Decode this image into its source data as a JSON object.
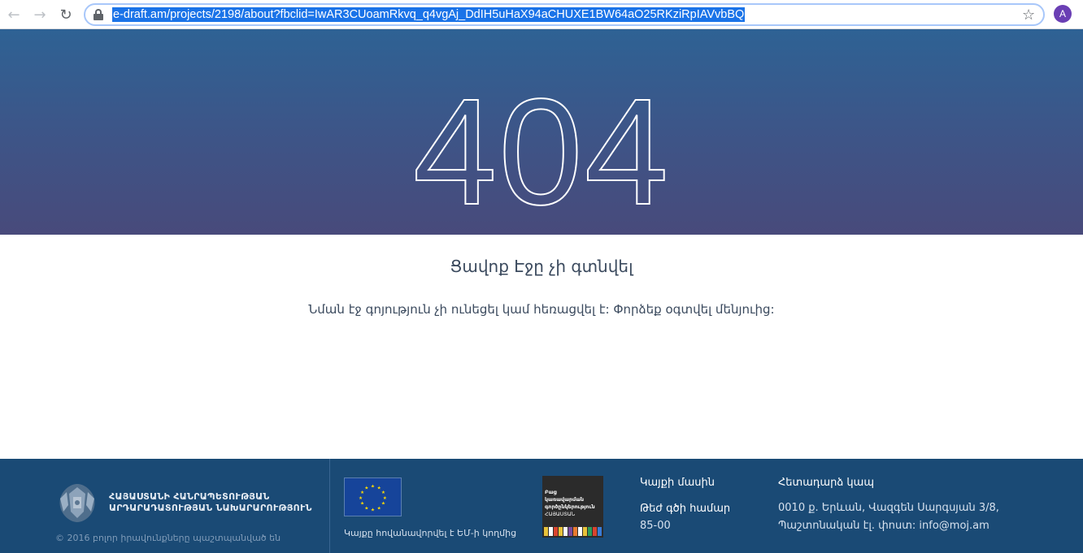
{
  "browser": {
    "back_icon": "arrow-left-icon",
    "forward_icon": "arrow-right-icon",
    "reload_icon": "reload-icon",
    "url": "e-draft.am/projects/2198/about?fbclid=IwAR3CUoamRkvq_q4vgAj_DdIH5uHaX94aCHUXE1BW64aO25RKziRpIAVvbBQ",
    "avatar_letter": "A",
    "accent_color": "#1a73e8",
    "avatar_color": "#6a3fb4"
  },
  "hero": {
    "code": "404",
    "gradient_top": "#2e6294",
    "gradient_bottom": "#484a7b"
  },
  "content": {
    "title": "Ցավոք Էջը չի գտնվել",
    "body": "Նման էջ գոյություն չի ունեցել կամ հեռացվել է: Փորձեք օգտվել մենյուից:"
  },
  "footer": {
    "background": "#1a4a75",
    "ministry_line1": "ՀԱՅԱՍՏԱՆԻ ՀԱՆՐԱՊԵՏՈՒԹՅԱՆ",
    "ministry_line2": "ԱՐԴԱՐԱԴԱՏՈՒԹՅԱՆ ՆԱԽԱՐԱՐՈՒԹՅՈՒՆ",
    "copyright": "© 2016 բոլոր իրավունքները պաշտպանված են",
    "eu_caption": "Կայքը հովանավորվել է ԵՄ-ի կողմից",
    "ogp_line1": "Բաց",
    "ogp_line2": "կառավարման",
    "ogp_line3": "գործընկերություն",
    "ogp_line4": "ՀԱՅԱՍՏԱՆ",
    "about_link": "Կայքի մասին",
    "hotline_label": "Թեժ գծի համար",
    "hotline_number": "85-00",
    "contact_title": "Հետադարձ կապ",
    "address": "0010 ք. Երևան, Վազգեն Սարգսյան 3/8,",
    "email_line": "Պաշտոնական էլ. փոստ: info@moj.am"
  }
}
